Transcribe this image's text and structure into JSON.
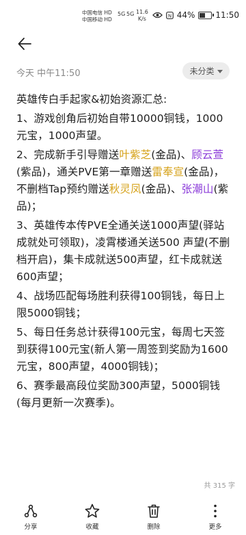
{
  "status_bar": {
    "carrier_1": "中国电信",
    "carrier_1_tag": "HD",
    "carrier_2": "中国移动",
    "carrier_2_tag": "HD",
    "signal_1": "5G",
    "signal_2": "5G",
    "net_speed_value": "11.6",
    "net_speed_unit": "K/s",
    "battery_text": "44%",
    "battery_level": 0.44,
    "time": "11:50"
  },
  "meta": {
    "date": "今天 中午11:50",
    "category": "未分类"
  },
  "note": {
    "title": "英雄传白手起家&初始资源汇总:",
    "items": [
      [
        {
          "t": "1、游戏创角后初始自带10000铜钱，1000元宝，1000声望。",
          "c": ""
        }
      ],
      [
        {
          "t": "2、完成新手引导赠送",
          "c": ""
        },
        {
          "t": "叶紫芝",
          "c": "gold"
        },
        {
          "t": "(金品)、",
          "c": ""
        },
        {
          "t": "顾云萱",
          "c": "purple"
        },
        {
          "t": "(紫品)，通关PVE第一章赠送",
          "c": ""
        },
        {
          "t": "雷奉宣",
          "c": "gold"
        },
        {
          "t": "(金品)，不删档Tap预约赠送",
          "c": ""
        },
        {
          "t": "秋灵凤",
          "c": "gold"
        },
        {
          "t": "(金品)、",
          "c": ""
        },
        {
          "t": "张潮山",
          "c": "purple"
        },
        {
          "t": "(紫品)；",
          "c": ""
        }
      ],
      [
        {
          "t": "3、英雄传本传PVE全通关送1000声望(驿站成就处可领取)，凌霄楼通关送500 声望(不删档开启)，集卡成就送500声望，红卡成就送600声望；",
          "c": ""
        }
      ],
      [
        {
          "t": "4、战场匹配每场胜利获得100铜钱，每日上限5000铜钱；",
          "c": ""
        }
      ],
      [
        {
          "t": "5、每日任务总计获得100元宝，每周七天签到获得100元宝(新人第一周签到奖励为1600元宝，800声望，4000铜钱)；",
          "c": ""
        }
      ],
      [
        {
          "t": "6、赛季最高段位奖励300声望，5000铜钱(每月更新一次赛季)。",
          "c": ""
        }
      ]
    ],
    "char_count": "共 315 字"
  },
  "colors": {
    "gold": "#d6a21a",
    "purple": "#8b3bd9"
  },
  "toolbar": [
    {
      "label": "分享",
      "icon": "share-icon"
    },
    {
      "label": "收藏",
      "icon": "star-icon"
    },
    {
      "label": "删除",
      "icon": "trash-icon"
    },
    {
      "label": "更多",
      "icon": "more-icon"
    }
  ]
}
